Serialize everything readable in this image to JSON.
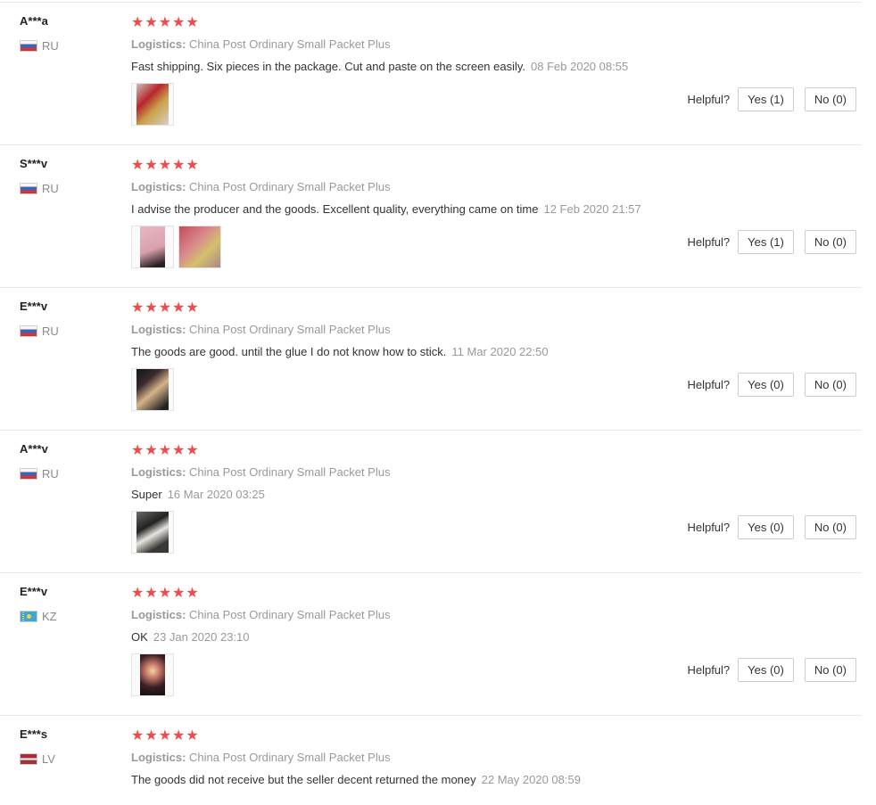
{
  "helpful_label": "Helpful?",
  "logistics_label": "Logistics:",
  "stars": "★★★★★",
  "colors": {
    "star": "#f04a4d",
    "muted": "#999999",
    "border": "#e8e8e8"
  },
  "reviews": [
    {
      "user": "A***a",
      "country": "RU",
      "flag": "ru",
      "rating": 5,
      "logistics": "China Post Ordinary Small Packet Plus",
      "text": "Fast shipping. Six pieces in the package. Cut and paste on the screen easily.",
      "date": "08 Feb 2020 08:55",
      "photos": 1,
      "yes": "Yes (1)",
      "no": "No (0)"
    },
    {
      "user": "S***v",
      "country": "RU",
      "flag": "ru",
      "rating": 5,
      "logistics": "China Post Ordinary Small Packet Plus",
      "text": "I advise the producer and the goods. Excellent quality, everything came on time",
      "date": "12 Feb 2020 21:57",
      "photos": 2,
      "yes": "Yes (1)",
      "no": "No (0)"
    },
    {
      "user": "E***v",
      "country": "RU",
      "flag": "ru",
      "rating": 5,
      "logistics": "China Post Ordinary Small Packet Plus",
      "text": "The goods are good. until the glue I do not know how to stick.",
      "date": "11 Mar 2020 22:50",
      "photos": 1,
      "yes": "Yes (0)",
      "no": "No (0)"
    },
    {
      "user": "A***v",
      "country": "RU",
      "flag": "ru",
      "rating": 5,
      "logistics": "China Post Ordinary Small Packet Plus",
      "text": "Super",
      "date": "16 Mar 2020 03:25",
      "photos": 1,
      "yes": "Yes (0)",
      "no": "No (0)"
    },
    {
      "user": "E***v",
      "country": "KZ",
      "flag": "kz",
      "rating": 5,
      "logistics": "China Post Ordinary Small Packet Plus",
      "text": "OK",
      "date": "23 Jan 2020 23:10",
      "photos": 1,
      "yes": "Yes (0)",
      "no": "No (0)"
    },
    {
      "user": "E***s",
      "country": "LV",
      "flag": "lv",
      "rating": 5,
      "logistics": "China Post Ordinary Small Packet Plus",
      "text": "The goods did not receive but the seller decent returned the money",
      "date": "22 May 2020 08:59",
      "photos": 0,
      "yes": "",
      "no": ""
    }
  ]
}
